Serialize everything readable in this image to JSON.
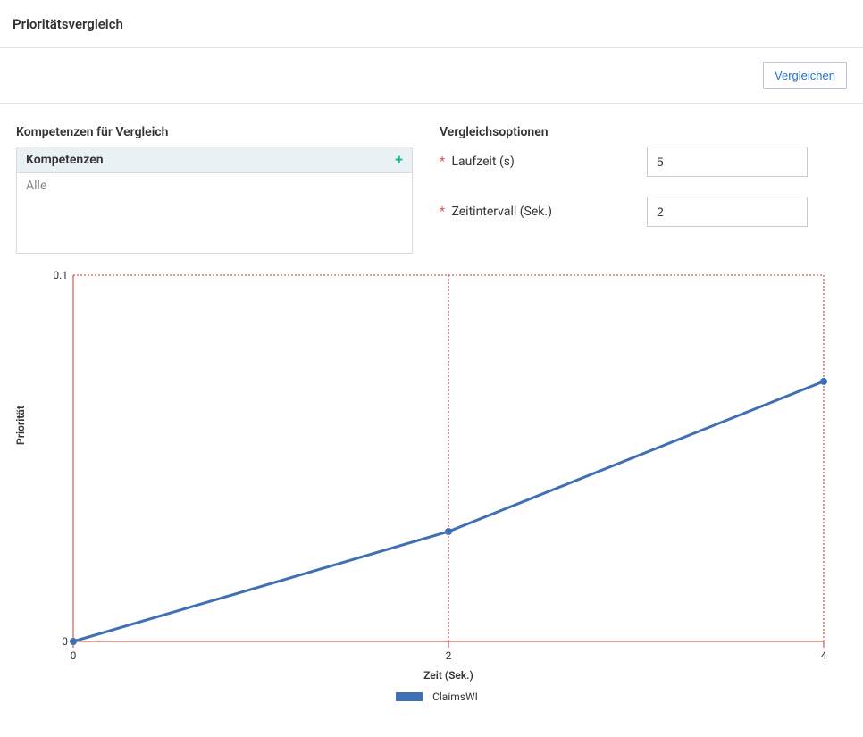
{
  "header": {
    "title": "Prioritätsvergleich"
  },
  "actions": {
    "compare_label": "Vergleichen"
  },
  "left": {
    "title": "Kompetenzen für Vergleich",
    "header": "Kompetenzen",
    "item0": "Alle"
  },
  "right": {
    "title": "Vergleichsoptionen",
    "opt1_label": "Laufzeit (s)",
    "opt1_value": "5",
    "opt2_label": "Zeitintervall (Sek.)",
    "opt2_value": "2"
  },
  "chart": {
    "xlabel": "Zeit (Sek.)",
    "ylabel": "Priorität",
    "legend0": "ClaimsWI",
    "xtick0": "0",
    "xtick1": "2",
    "xtick2": "4",
    "ytick0": "0",
    "ytick1": "0.1"
  },
  "chart_data": {
    "type": "line",
    "xlabel": "Zeit (Sek.)",
    "ylabel": "Priorität",
    "xlim": [
      0,
      4
    ],
    "ylim": [
      0,
      0.1
    ],
    "xticks": [
      0,
      2,
      4
    ],
    "yticks": [
      0,
      0.1
    ],
    "series": [
      {
        "name": "ClaimsWI",
        "x": [
          0,
          2,
          4
        ],
        "y": [
          0.0,
          0.03,
          0.071
        ],
        "color": "#3f6fb5"
      }
    ],
    "grid_vertical": [
      0,
      2,
      4
    ],
    "grid_horizontal": [
      0,
      0.1
    ]
  }
}
